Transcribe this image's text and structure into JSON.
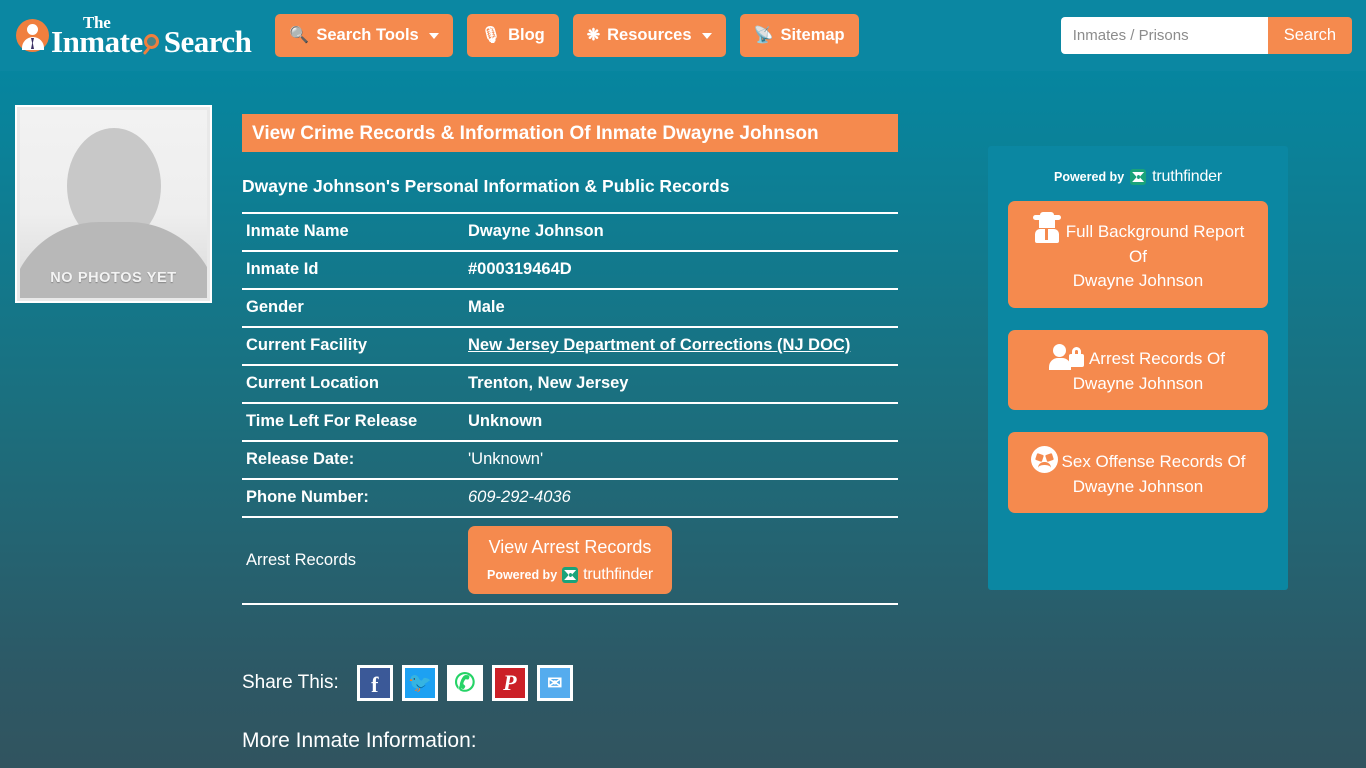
{
  "header": {
    "logo": {
      "the": "The",
      "main_part1": "Inmate",
      "main_part2": "Search",
      "icon": "person-badge-icon",
      "glass_icon": "magnifier-icon"
    },
    "nav": [
      {
        "label": "Search Tools",
        "icon": "magnifier-icon",
        "has_caret": true
      },
      {
        "label": "Blog",
        "icon": "blog-icon",
        "has_caret": false
      },
      {
        "label": "Resources",
        "icon": "resources-icon",
        "has_caret": true
      },
      {
        "label": "Sitemap",
        "icon": "rss-icon",
        "has_caret": false
      }
    ],
    "search": {
      "placeholder": "Inmates / Prisons",
      "value": "",
      "button_label": "Search"
    }
  },
  "photo": {
    "label": "NO PHOTOS YET",
    "alt": "inmate-photo-placeholder"
  },
  "main": {
    "page_title": "View Crime Records & Information Of Inmate Dwayne Johnson",
    "subtitle": "Dwayne Johnson's Personal Information & Public Records",
    "rows": [
      {
        "label": "Inmate Name",
        "value": "Dwayne Johnson",
        "style": "bold"
      },
      {
        "label": "Inmate Id",
        "value": "#000319464D",
        "style": "bold"
      },
      {
        "label": "Gender",
        "value": "Male",
        "style": "bold"
      },
      {
        "label": "Current Facility",
        "value": "New Jersey Department of Corrections (NJ DOC)",
        "style": "link"
      },
      {
        "label": "Current Location",
        "value": "Trenton, New Jersey",
        "style": "bold"
      },
      {
        "label": "Time Left For Release",
        "value": "Unknown",
        "style": "bold"
      },
      {
        "label": "Release Date:",
        "value": "'Unknown'",
        "style": "plain"
      },
      {
        "label": "Phone Number:",
        "value": "609-292-4036",
        "style": "italic"
      }
    ],
    "arrest_row": {
      "label": "Arrest Records",
      "button_label": "View Arrest Records",
      "powered_by": "Powered by",
      "brand": "truthfinder"
    }
  },
  "share": {
    "label": "Share This:",
    "buttons": [
      {
        "name": "facebook",
        "glyph": "f"
      },
      {
        "name": "twitter",
        "glyph": "🐦"
      },
      {
        "name": "whatsapp",
        "glyph": "✆"
      },
      {
        "name": "pinterest",
        "glyph": "P"
      },
      {
        "name": "email",
        "glyph": "✉"
      }
    ]
  },
  "more_info_heading": "More Inmate Information:",
  "sidebar": {
    "powered_by": "Powered by",
    "brand": "truthfinder",
    "buttons": [
      {
        "icon": "spy-icon",
        "line1": "Full Background Report",
        "line2": "Of",
        "line3": "Dwayne Johnson"
      },
      {
        "icon": "person-lock-icon",
        "line1": "Arrest Records Of",
        "line2": "Dwayne Johnson",
        "line3": ""
      },
      {
        "icon": "angry-face-icon",
        "line1": "Sex Offense Records Of",
        "line2": "Dwayne Johnson",
        "line3": ""
      }
    ]
  },
  "colors": {
    "accent_orange": "#f58a4e",
    "header_teal": "#0b87a2",
    "bg_top": "#0289a6",
    "bg_bottom": "#31545f",
    "facebook": "#3b5998",
    "twitter": "#1da1f2",
    "whatsapp": "#25d366",
    "pinterest": "#cb2027",
    "email": "#55acee"
  }
}
